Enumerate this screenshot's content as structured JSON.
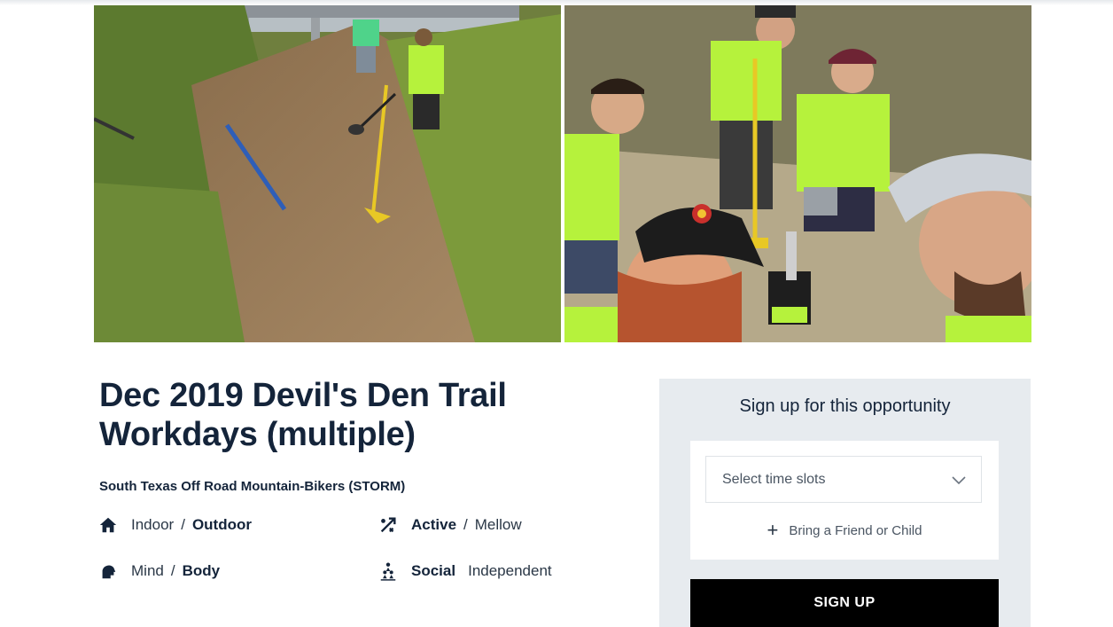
{
  "event": {
    "title": "Dec 2019 Devil's Den Trail Workdays (multiple)",
    "organization": "South Texas Off Road Mountain-Bikers (STORM)"
  },
  "attributes": {
    "location": {
      "icon": "house-icon",
      "option_a": "Indoor",
      "separator": "/",
      "option_b": "Outdoor",
      "selected": "Outdoor"
    },
    "activity": {
      "icon": "percent-shuffle-icon",
      "option_a": "Active",
      "separator": "/",
      "option_b": "Mellow",
      "selected": "Active"
    },
    "focus": {
      "icon": "head-icon",
      "option_a": "Mind",
      "separator": "/",
      "option_b": "Body",
      "selected": "Body"
    },
    "setting": {
      "icon": "people-tree-icon",
      "option_a": "Social",
      "option_b": "Independent",
      "selected": "Social"
    }
  },
  "signup": {
    "heading": "Sign up for this opportunity",
    "time_slots_placeholder": "Select time slots",
    "bring_friend_label": "Bring a Friend or Child",
    "button_label": "SIGN UP"
  },
  "colors": {
    "title": "#14243a",
    "panel_bg": "#e7ebef",
    "button_bg": "#000000",
    "safety_vest": "#b6f23c"
  }
}
